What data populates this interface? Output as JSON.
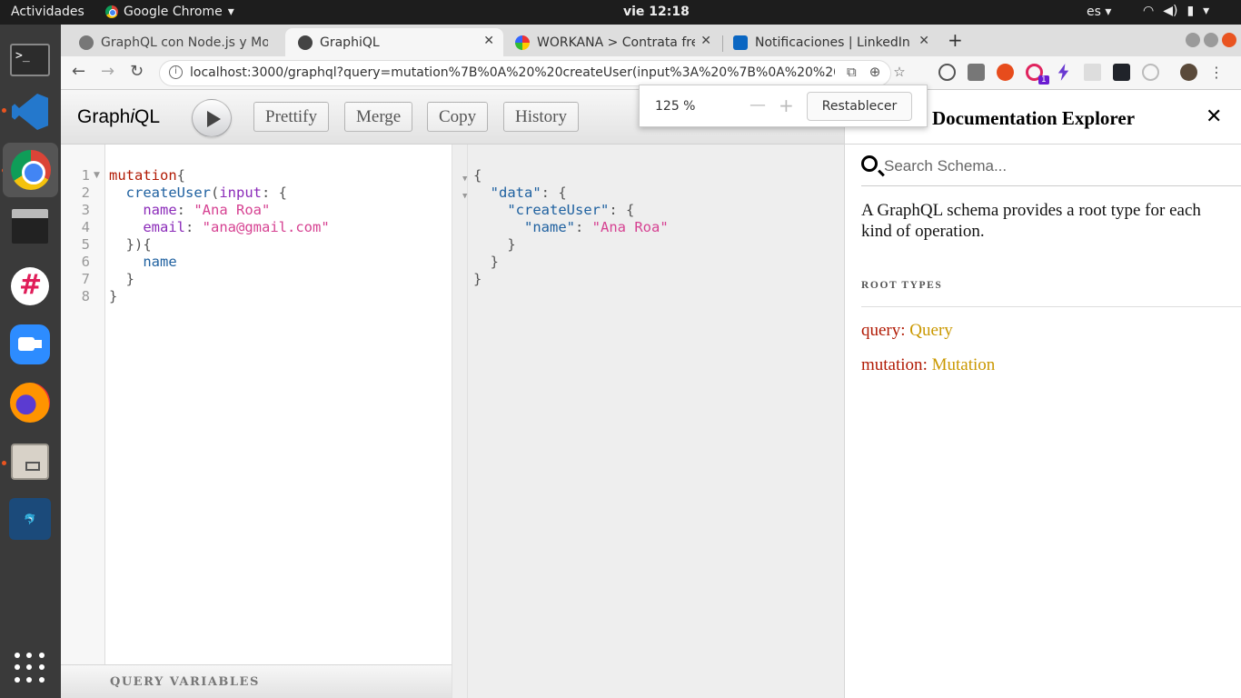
{
  "os": {
    "activities": "Actividades",
    "app_name": "Google Chrome",
    "clock": "vie 12:18",
    "lang": "es"
  },
  "tabs": [
    {
      "title": "GraphQL con Node.js y Mo",
      "active": false
    },
    {
      "title": "GraphiQL",
      "active": true
    },
    {
      "title": "WORKANA > Contrata fre",
      "active": false
    },
    {
      "title": "Notificaciones | LinkedIn",
      "active": false
    }
  ],
  "omnibox": {
    "url": "localhost:3000/graphql?query=mutation%7B%0A%20%20createUser(input%3A%20%7B%0A%20%20%20%...",
    "ext_badge": "1"
  },
  "zoom_popup": {
    "percent": "125 %",
    "minus": "—",
    "plus": "+",
    "reset_label": "Restablecer"
  },
  "graphiql": {
    "title_pre": "Graph",
    "title_i": "i",
    "title_post": "QL",
    "buttons": {
      "prettify": "Prettify",
      "merge": "Merge",
      "copy": "Copy",
      "history": "History"
    },
    "query_variables_label": "QUERY VARIABLES",
    "line_numbers": [
      "1",
      "2",
      "3",
      "4",
      "5",
      "6",
      "7",
      "8"
    ],
    "query": {
      "l1_kw": "mutation",
      "l1_brace": "{",
      "l2_field": "createUser",
      "l2_paren": "(",
      "l2_arg": "input",
      "l2_rest": ": {",
      "l3_name": "name",
      "l3_colon": ": ",
      "l3_val": "\"Ana Roa\"",
      "l4_name": "email",
      "l4_colon": ": ",
      "l4_val": "\"ana@gmail.com\"",
      "l5": "}){",
      "l6_field": "name",
      "l7": "}",
      "l8": "}"
    },
    "result": {
      "open": "{",
      "data_key": "\"data\"",
      "colon_brace": ": {",
      "create_key": "\"createUser\"",
      "name_key": "\"name\"",
      "name_colon": ": ",
      "name_val": "\"Ana Roa\"",
      "close3": "}",
      "close2": "}",
      "close1": "}"
    }
  },
  "docs": {
    "title": "Documentation Explorer",
    "close": "✕",
    "search_placeholder": "Search Schema...",
    "description": "A GraphQL schema provides a root type for each kind of operation.",
    "section": "ROOT TYPES",
    "fields": [
      {
        "name": "query",
        "type": "Query"
      },
      {
        "name": "mutation",
        "type": "Mutation"
      }
    ]
  }
}
